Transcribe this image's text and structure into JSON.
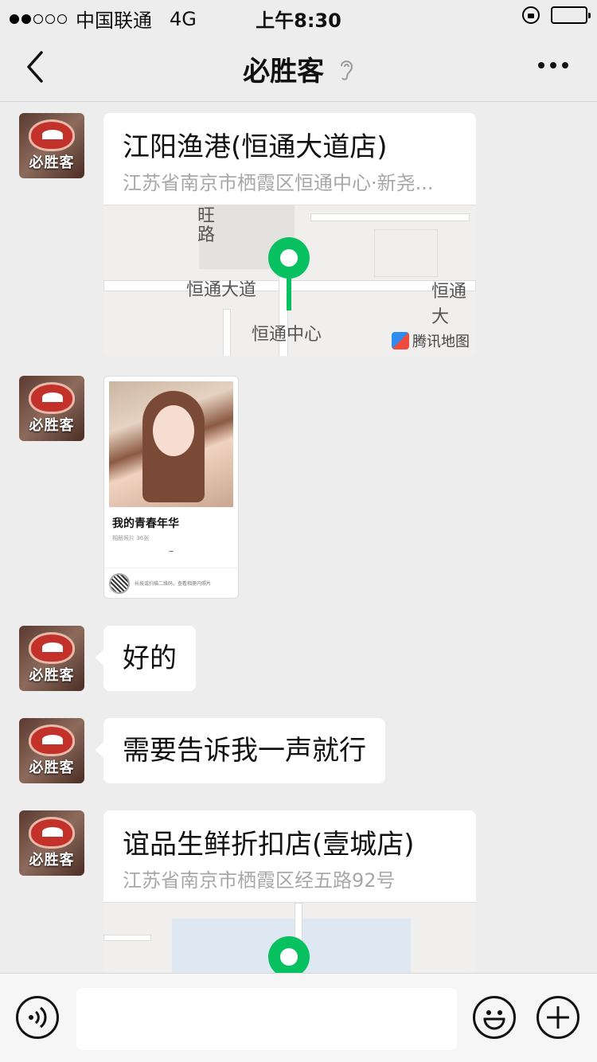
{
  "status_bar": {
    "carrier": "中国联通",
    "network": "4G",
    "time": "上午8:30",
    "signal_bars_filled": 2,
    "signal_bars_total": 5
  },
  "nav": {
    "title": "必胜客",
    "back_icon": "chevron-left-icon",
    "mode_icon": "ear-icon",
    "more_icon": "more-icon"
  },
  "avatar_text": "必胜客",
  "messages": [
    {
      "type": "location",
      "title": "江阳渔港(恒通大道店)",
      "address": "江苏省南京市栖霞区恒通中心·新尧...",
      "map_labels": [
        "恒通大道",
        "恒通中心",
        "恒通大",
        "旺路"
      ],
      "map_provider": "腾讯地图"
    },
    {
      "type": "photo_card",
      "title": "我的青春年华",
      "subtitle": "相册照片 36张",
      "dash": "–",
      "footer": "长按或扫描二维码，查看相册内照片"
    },
    {
      "type": "text",
      "text": "好的"
    },
    {
      "type": "text",
      "text": "需要告诉我一声就行"
    },
    {
      "type": "location",
      "title": "谊品生鲜折扣店(壹城店)",
      "address": "江苏省南京市栖霞区经五路92号"
    }
  ],
  "input_bar": {
    "voice_icon": "voice-icon",
    "emoji_icon": "emoji-icon",
    "plus_icon": "plus-icon",
    "value": ""
  },
  "colors": {
    "accent_green": "#07c160",
    "background": "#ededed",
    "bubble": "#ffffff"
  }
}
